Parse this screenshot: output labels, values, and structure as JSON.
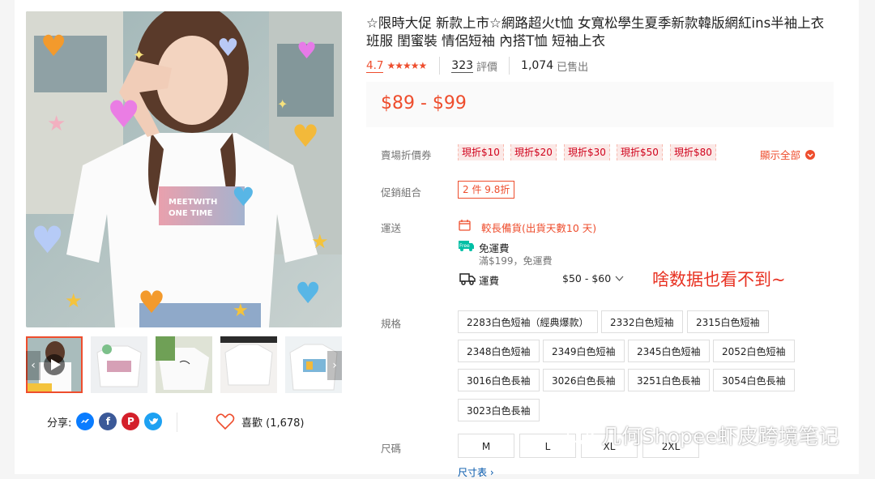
{
  "product": {
    "title": "☆限時大促 新款上市☆網路超火t恤 女寬松學生夏季新款韓版網紅ins半袖上衣 班服 閨蜜裝 情侶短袖 內搭T恤 短袖上衣",
    "rating": "4.7",
    "stars": "★★★★★",
    "reviews_count": "323",
    "reviews_label": "評價",
    "sold_count": "1,074",
    "sold_label": "已售出",
    "price": "$89 - $99"
  },
  "gallery": {
    "main_image_text": "MEETWITH ONE TIME",
    "thumbnails": [
      "thumb-1",
      "thumb-2",
      "thumb-3",
      "thumb-4",
      "thumb-5"
    ],
    "next_arrow": "›",
    "prev_arrow": "‹"
  },
  "share": {
    "label": "分享:",
    "icons": [
      "messenger-icon",
      "facebook-icon",
      "pinterest-icon",
      "twitter-icon"
    ]
  },
  "like": {
    "label": "喜歡 (1,678)"
  },
  "vouchers": {
    "label": "賣場折價券",
    "items": [
      "現折$10",
      "現折$20",
      "現折$30",
      "現折$50",
      "現折$80"
    ],
    "show_all": "顯示全部"
  },
  "promo": {
    "label": "促銷組合",
    "tag": "2 件 9.8折"
  },
  "shipping": {
    "label": "運送",
    "preorder": "較長備貨(出貨天數10 天)",
    "free_badge": "Free",
    "free_label": "免運費",
    "free_condition": "滿$199，免運費",
    "fee_label": "運費",
    "fee_range": "$50 - $60"
  },
  "annotation": "啥数据也看不到~",
  "variations": {
    "label": "規格",
    "options": [
      "2283白色短袖（經典爆款）",
      "2332白色短袖",
      "2315白色短袖",
      "2348白色短袖",
      "2349白色短袖",
      "2345白色短袖",
      "2052白色短袖",
      "3016白色長袖",
      "3026白色長袖",
      "3251白色長袖",
      "3054白色長袖",
      "3023白色長袖"
    ]
  },
  "sizes": {
    "label": "尺碼",
    "options": [
      "M",
      "L",
      "XL",
      "2XL"
    ],
    "size_chart": "尺寸表 ›"
  },
  "watermark": "几何Shopee虾皮跨境笔记",
  "colors": {
    "accent": "#ee4d2d",
    "annotation": "#e83222"
  }
}
